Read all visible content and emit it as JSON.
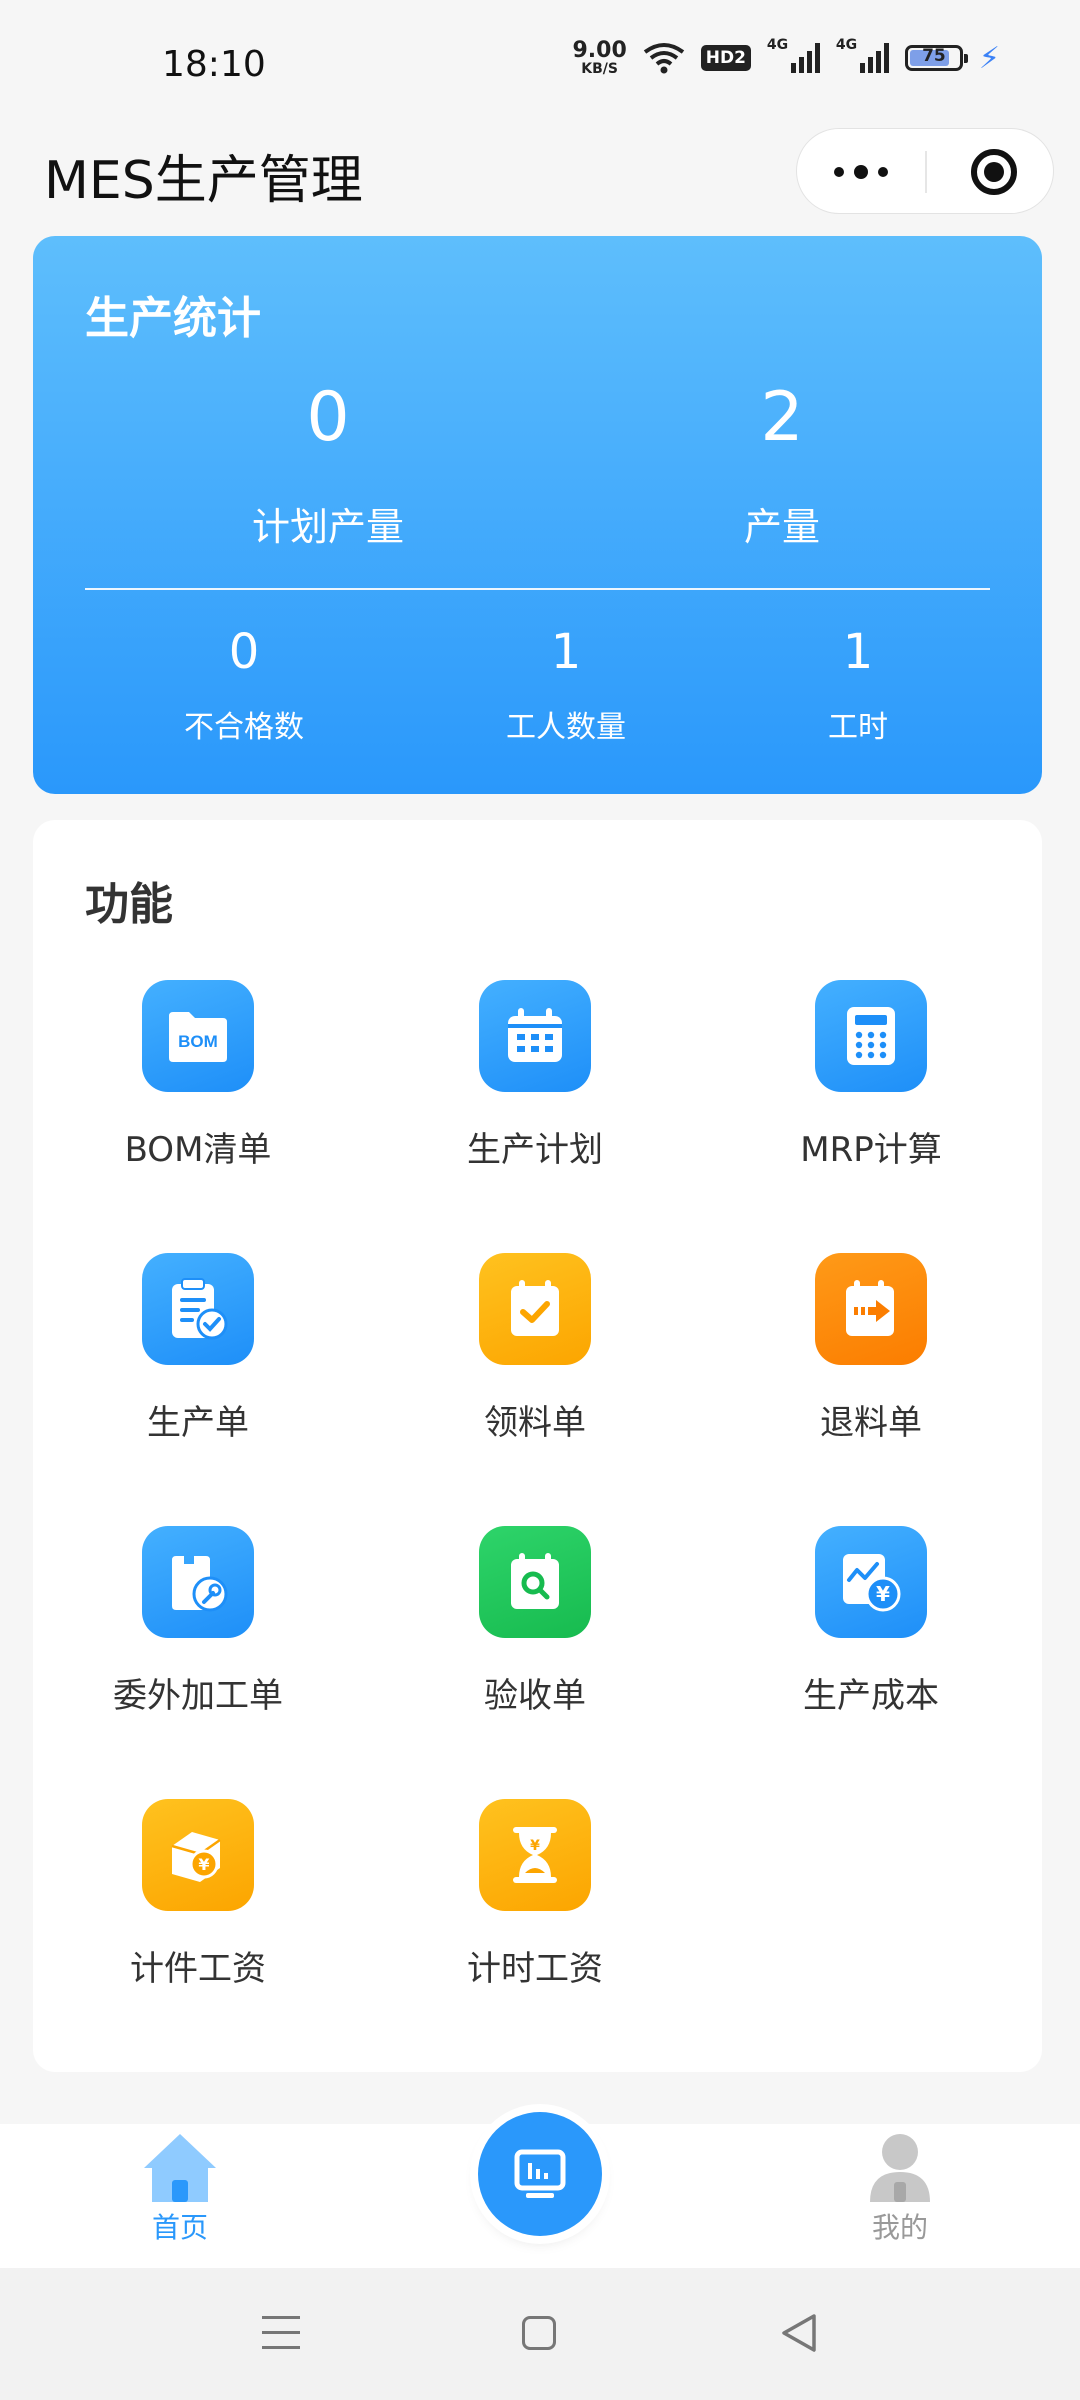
{
  "status_bar": {
    "time": "18:10",
    "net_speed_value": "9.00",
    "net_speed_unit": "KB/S",
    "hd_badge": "HD2",
    "signal1_label": "4G",
    "signal2_label": "4G",
    "battery": "75"
  },
  "header": {
    "title": "MES生产管理"
  },
  "stats": {
    "title": "生产统计",
    "primary": [
      {
        "value": "0",
        "label": "计划产量"
      },
      {
        "value": "2",
        "label": "产量"
      }
    ],
    "secondary": [
      {
        "value": "0",
        "label": "不合格数"
      },
      {
        "value": "1",
        "label": "工人数量"
      },
      {
        "value": "1",
        "label": "工时"
      }
    ]
  },
  "functions": {
    "title": "功能",
    "items": [
      {
        "label": "BOM清单",
        "icon": "bom-folder-icon",
        "icon_text": "BOM",
        "color": "#1e8ff8"
      },
      {
        "label": "生产计划",
        "icon": "calendar-icon",
        "color": "#1e8ff8"
      },
      {
        "label": "MRP计算",
        "icon": "calculator-icon",
        "color": "#1e8ff8"
      },
      {
        "label": "生产单",
        "icon": "clipboard-check-icon",
        "color": "#1e8ff8"
      },
      {
        "label": "领料单",
        "icon": "checklist-icon",
        "color": "#fca500"
      },
      {
        "label": "退料单",
        "icon": "return-arrow-icon",
        "color": "#fb7d00"
      },
      {
        "label": "委外加工单",
        "icon": "outsource-wrench-icon",
        "color": "#1e8ff8"
      },
      {
        "label": "验收单",
        "icon": "inspection-search-icon",
        "color": "#17bb4f"
      },
      {
        "label": "生产成本",
        "icon": "cost-chart-yen-icon",
        "color": "#1e8ff8"
      },
      {
        "label": "计件工资",
        "icon": "piece-wage-box-icon",
        "color": "#fca500"
      },
      {
        "label": "计时工资",
        "icon": "hourglass-wage-icon",
        "color": "#fca500"
      }
    ]
  },
  "tabbar": {
    "home_label": "首页",
    "mine_label": "我的",
    "active_color": "#2a98fb",
    "inactive_color": "#999999"
  }
}
